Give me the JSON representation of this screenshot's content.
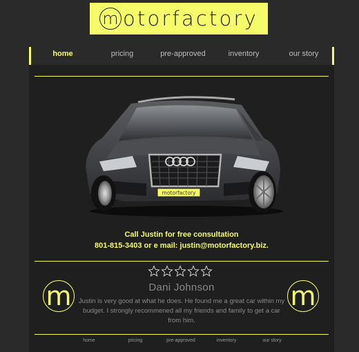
{
  "logo": {
    "initial": "m",
    "rest": "otorfactory"
  },
  "nav": {
    "items": [
      {
        "label": "home",
        "active": true
      },
      {
        "label": "pricing",
        "active": false
      },
      {
        "label": "pre-approved",
        "active": false
      },
      {
        "label": "inventory",
        "active": false
      },
      {
        "label": "our story",
        "active": false
      }
    ]
  },
  "hero": {
    "plate_text": "motorfactory"
  },
  "contact": {
    "line1": "Call Justin for free consultation",
    "line2": "801-815-3403 or e mail: justin@motorfactory.biz."
  },
  "review": {
    "stars": 5,
    "name": "Dani Johnson",
    "text": "Justin is very good at what he does. He found me a great car within my budget. I strongly recommened all my friends and family to get a car from him.",
    "badge_letter": "m"
  },
  "footer": {
    "items": [
      "home",
      "pricing",
      "pre-approved",
      "inventory",
      "our story"
    ]
  },
  "colors": {
    "accent": "#f6fb6a",
    "background": "#2a2a2a",
    "panel": "#1f1f1f"
  }
}
